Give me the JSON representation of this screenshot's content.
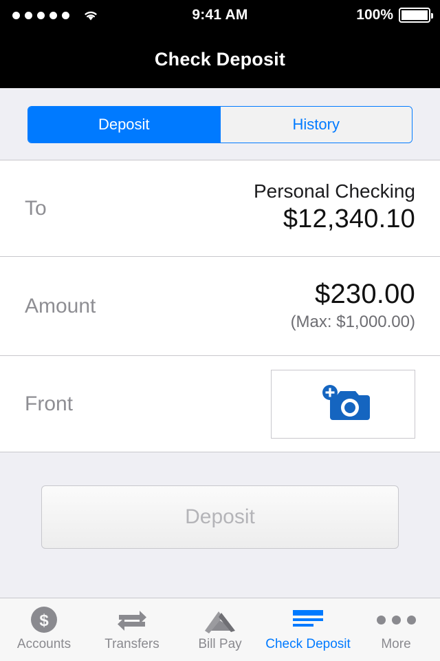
{
  "status_bar": {
    "signal_dots": 5,
    "wifi_icon": "wifi-icon",
    "time": "9:41 AM",
    "battery_percent": "100%",
    "battery_icon": "battery-full-icon"
  },
  "nav": {
    "title": "Check Deposit"
  },
  "segmented": {
    "options": [
      {
        "label": "Deposit",
        "active": true
      },
      {
        "label": "History",
        "active": false
      }
    ]
  },
  "form": {
    "to": {
      "label": "To",
      "account_name": "Personal Checking",
      "balance": "$12,340.10"
    },
    "amount": {
      "label": "Amount",
      "value": "$230.00",
      "max_note": "(Max: $1,000.00)"
    },
    "front": {
      "label": "Front",
      "camera_icon": "camera-add-icon"
    }
  },
  "cta": {
    "deposit_label": "Deposit"
  },
  "tabbar": {
    "items": [
      {
        "label": "Accounts",
        "icon": "dollar-circle-icon",
        "active": false
      },
      {
        "label": "Transfers",
        "icon": "transfer-arrows-icon",
        "active": false
      },
      {
        "label": "Bill Pay",
        "icon": "envelope-icon",
        "active": false
      },
      {
        "label": "Check Deposit",
        "icon": "check-lines-icon",
        "active": true
      },
      {
        "label": "More",
        "icon": "ellipsis-icon",
        "active": false
      }
    ]
  },
  "colors": {
    "accent": "#007aff",
    "label_gray": "#8e8e93",
    "bg_gray": "#efeff4"
  }
}
